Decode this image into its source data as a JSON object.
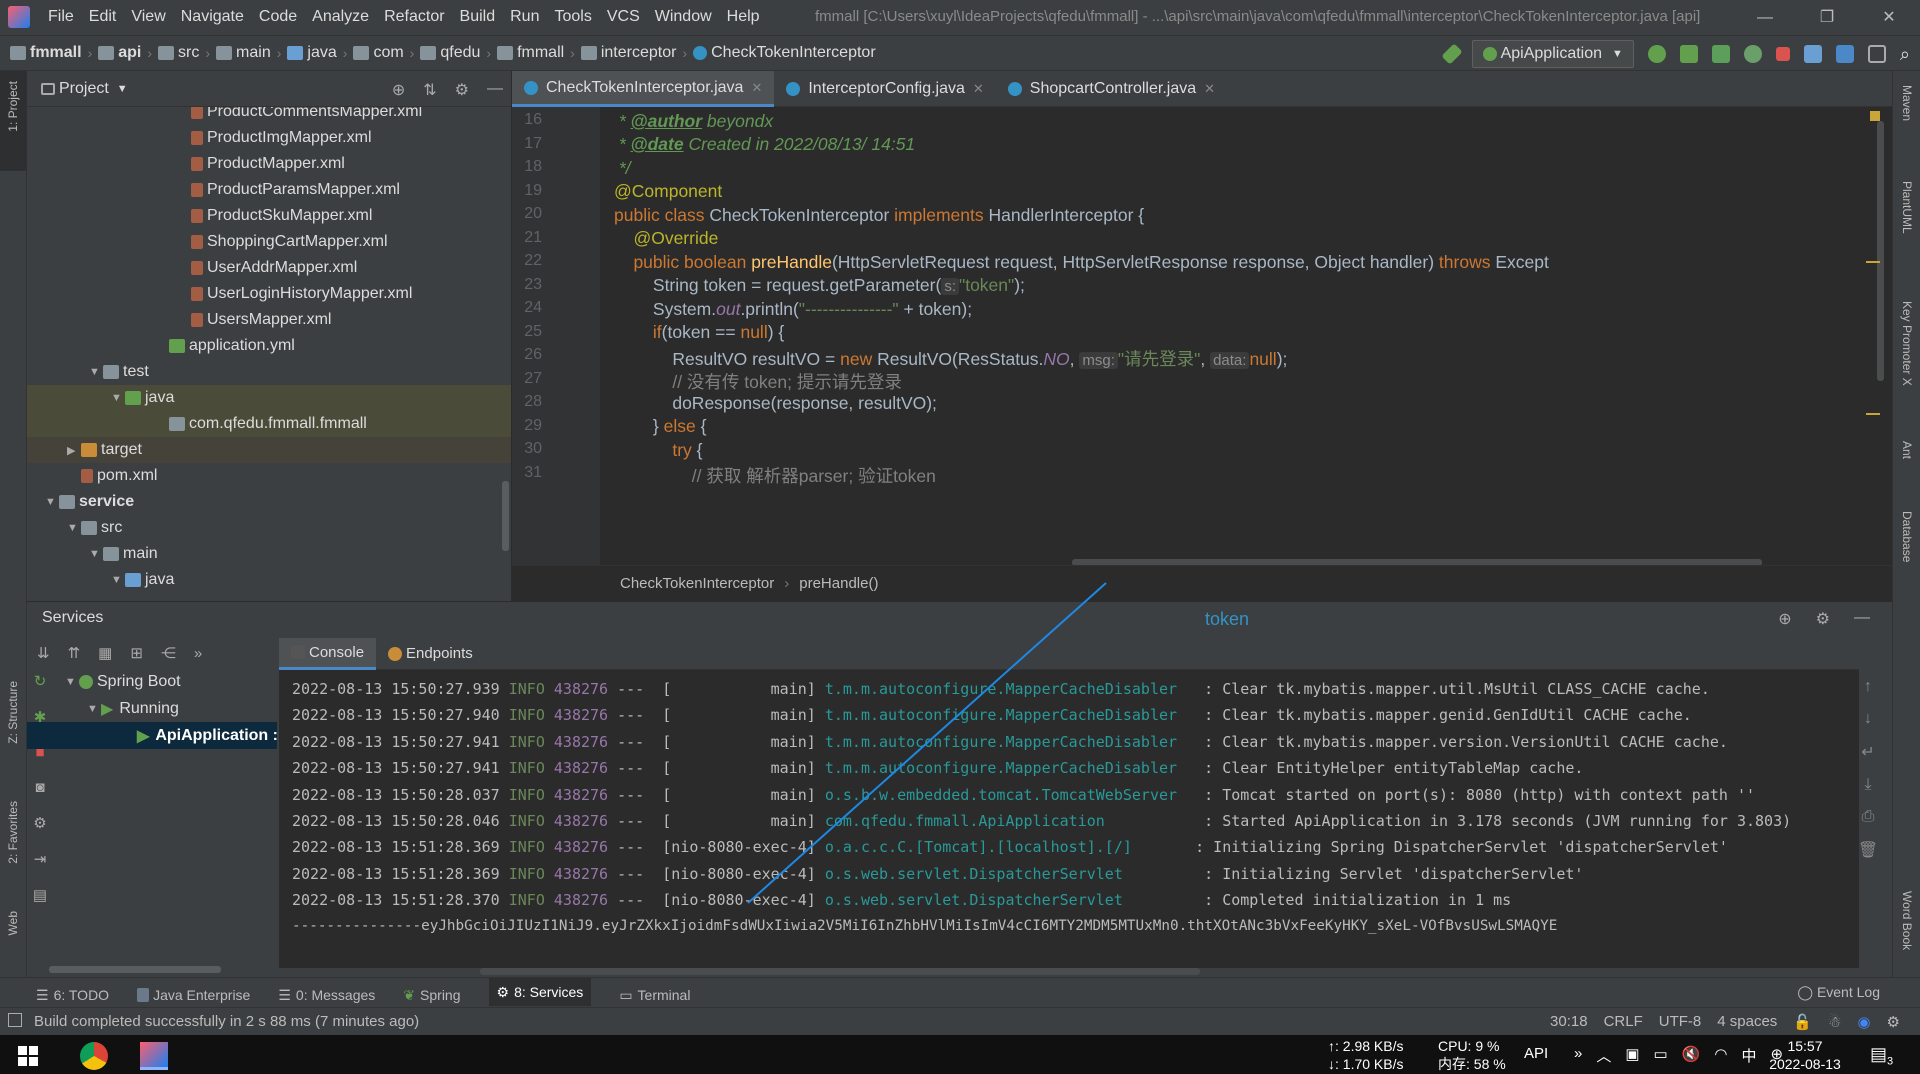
{
  "menubar": {
    "items": [
      "File",
      "Edit",
      "View",
      "Navigate",
      "Code",
      "Analyze",
      "Refactor",
      "Build",
      "Run",
      "Tools",
      "VCS",
      "Window",
      "Help"
    ],
    "title": "fmmall [C:\\Users\\xuyl\\IdeaProjects\\qfedu\\fmmall] - ...\\api\\src\\main\\java\\com\\qfedu\\fmmall\\interceptor\\CheckTokenInterceptor.java [api]"
  },
  "breadcrumb": [
    "fmmall",
    "api",
    "src",
    "main",
    "java",
    "com",
    "qfedu",
    "fmmall",
    "interceptor",
    "CheckTokenInterceptor"
  ],
  "run_config": "ApiApplication",
  "left_stripe": {
    "project": "1: Project",
    "structure": "Z: Structure",
    "favorites": "2: Favorites",
    "web": "Web"
  },
  "right_stripe": {
    "maven": "Maven",
    "plantuml": "PlantUML",
    "keypromoter": "Key Promoter X",
    "ant": "Ant",
    "database": "Database",
    "wordbook": "Word Book"
  },
  "project_panel": {
    "title": "Project",
    "tree": [
      {
        "label": "ProductCommentsMapper.xml",
        "kind": "xml",
        "depth": 7
      },
      {
        "label": "ProductImgMapper.xml",
        "kind": "xml",
        "depth": 7
      },
      {
        "label": "ProductMapper.xml",
        "kind": "xml",
        "depth": 7
      },
      {
        "label": "ProductParamsMapper.xml",
        "kind": "xml",
        "depth": 7
      },
      {
        "label": "ProductSkuMapper.xml",
        "kind": "xml",
        "depth": 7
      },
      {
        "label": "ShoppingCartMapper.xml",
        "kind": "xml",
        "depth": 7
      },
      {
        "label": "UserAddrMapper.xml",
        "kind": "xml",
        "depth": 7
      },
      {
        "label": "UserLoginHistoryMapper.xml",
        "kind": "xml",
        "depth": 7
      },
      {
        "label": "UsersMapper.xml",
        "kind": "xml",
        "depth": 7
      },
      {
        "label": "application.yml",
        "kind": "yml",
        "depth": 6
      },
      {
        "label": "test",
        "kind": "folder",
        "depth": 3,
        "arrow": "▼"
      },
      {
        "label": "java",
        "kind": "folder-green",
        "depth": 4,
        "arrow": "▼",
        "selected": true
      },
      {
        "label": "com.qfedu.fmmall.fmmall",
        "kind": "folder",
        "depth": 6,
        "selected": true
      },
      {
        "label": "target",
        "kind": "folder-orange",
        "depth": 2,
        "arrow": "▶",
        "selected2": true
      },
      {
        "label": "pom.xml",
        "kind": "maven",
        "depth": 2
      },
      {
        "label": "service",
        "kind": "folder",
        "depth": 1,
        "arrow": "▼",
        "bold": true
      },
      {
        "label": "src",
        "kind": "folder",
        "depth": 2,
        "arrow": "▼"
      },
      {
        "label": "main",
        "kind": "folder",
        "depth": 3,
        "arrow": "▼"
      },
      {
        "label": "java",
        "kind": "folder-blue",
        "depth": 4,
        "arrow": "▼"
      }
    ]
  },
  "editor": {
    "tabs": [
      {
        "label": "CheckTokenInterceptor.java",
        "active": true
      },
      {
        "label": "InterceptorConfig.java",
        "active": false
      },
      {
        "label": "ShopcartController.java",
        "active": false
      }
    ],
    "line_numbers": [
      "16",
      "17",
      "18",
      "19",
      "20",
      "21",
      "22",
      "23",
      "24",
      "25",
      "26",
      "27",
      "28",
      "29",
      "30",
      "31"
    ],
    "code": {
      "l16": [
        " * ",
        "@author",
        " beyondx"
      ],
      "l17": [
        " * ",
        "@date",
        " Created in 2022/08/13/ 14:51"
      ],
      "l18": " */",
      "l19": "@Component",
      "l20": [
        "public class ",
        "CheckTokenInterceptor ",
        "implements ",
        "HandlerInterceptor {"
      ],
      "l21": "    @Override",
      "l22": [
        "    public boolean ",
        "preHandle",
        "(HttpServletRequest request, HttpServletResponse response, Object handler) ",
        "throws ",
        "Except"
      ],
      "l23": [
        "        String token = request.getParameter(",
        "s:",
        "\"token\"",
        ");"
      ],
      "l24": [
        "        System.",
        "out",
        ".println(",
        "\"---------------\"",
        " + token);"
      ],
      "l25": [
        "        ",
        "if",
        "(token == ",
        "null",
        ") {"
      ],
      "l26": [
        "            ResultVO resultVO = ",
        "new ",
        "ResultVO(ResStatus.",
        "NO",
        ", ",
        "msg:",
        "\"请先登录\"",
        ", ",
        "data:",
        "null",
        ");"
      ],
      "l27": "            // 没有传 token; 提示请先登录",
      "l28": "            doResponse(response, resultVO);",
      "l29": [
        "        } ",
        "else ",
        "{"
      ],
      "l30": [
        "            ",
        "try ",
        "{"
      ],
      "l31": "                // 获取 解析器parser; 验证token"
    },
    "breadcrumb": [
      "CheckTokenInterceptor",
      "preHandle()"
    ]
  },
  "services": {
    "title": "Services",
    "token_label": "token",
    "tree": [
      {
        "label": "Spring Boot",
        "arrow": "▼"
      },
      {
        "label": "Running",
        "arrow": "▼"
      },
      {
        "label": "ApiApplication :",
        "selected": true
      }
    ],
    "console_tabs": [
      "Console",
      "Endpoints"
    ],
    "logs": [
      {
        "ts": "2022-08-13 15:50:27.939",
        "level": "INFO",
        "pid": "438276",
        "thread": "---  [           main]",
        "logger": "t.m.m.autoconfigure.MapperCacheDisabler  ",
        "msg": ": Clear tk.mybatis.mapper.util.MsUtil CLASS_CACHE cache."
      },
      {
        "ts": "2022-08-13 15:50:27.940",
        "level": "INFO",
        "pid": "438276",
        "thread": "---  [           main]",
        "logger": "t.m.m.autoconfigure.MapperCacheDisabler  ",
        "msg": ": Clear tk.mybatis.mapper.genid.GenIdUtil CACHE cache."
      },
      {
        "ts": "2022-08-13 15:50:27.941",
        "level": "INFO",
        "pid": "438276",
        "thread": "---  [           main]",
        "logger": "t.m.m.autoconfigure.MapperCacheDisabler  ",
        "msg": ": Clear tk.mybatis.mapper.version.VersionUtil CACHE cache."
      },
      {
        "ts": "2022-08-13 15:50:27.941",
        "level": "INFO",
        "pid": "438276",
        "thread": "---  [           main]",
        "logger": "t.m.m.autoconfigure.MapperCacheDisabler  ",
        "msg": ": Clear EntityHelper entityTableMap cache."
      },
      {
        "ts": "2022-08-13 15:50:28.037",
        "level": "INFO",
        "pid": "438276",
        "thread": "---  [           main]",
        "logger": "o.s.b.w.embedded.tomcat.TomcatWebServer  ",
        "msg": ": Tomcat started on port(s): 8080 (http) with context path ''"
      },
      {
        "ts": "2022-08-13 15:50:28.046",
        "level": "INFO",
        "pid": "438276",
        "thread": "---  [           main]",
        "logger": "com.qfedu.fmmall.ApiApplication          ",
        "msg": ": Started ApiApplication in 3.178 seconds (JVM running for 3.803)"
      },
      {
        "ts": "2022-08-13 15:51:28.369",
        "level": "INFO",
        "pid": "438276",
        "thread": "---  [nio-8080-exec-4]",
        "logger": "o.a.c.c.C.[Tomcat].[localhost].[/]      ",
        "msg": ": Initializing Spring DispatcherServlet 'dispatcherServlet'"
      },
      {
        "ts": "2022-08-13 15:51:28.369",
        "level": "INFO",
        "pid": "438276",
        "thread": "---  [nio-8080-exec-4]",
        "logger": "o.s.web.servlet.DispatcherServlet        ",
        "msg": ": Initializing Servlet 'dispatcherServlet'"
      },
      {
        "ts": "2022-08-13 15:51:28.370",
        "level": "INFO",
        "pid": "438276",
        "thread": "---  [nio-8080-exec-4]",
        "logger": "o.s.web.servlet.DispatcherServlet        ",
        "msg": ": Completed initialization in 1 ms"
      }
    ],
    "token_line": "---------------eyJhbGciOiJIUzI1NiJ9.eyJrZXkxIjoidmFsdWUxIiwia2V5MiI6InZhbHVlMiIsImV4cCI6MTY2MDM5MTUxMn0.thtXOtANc3bVxFeeKyHKY_sXeL-VOfBvsUSwLSMAQYE"
  },
  "toolwindows": [
    {
      "label": "6: TODO"
    },
    {
      "label": "Java Enterprise"
    },
    {
      "label": "0: Messages"
    },
    {
      "label": "Spring"
    },
    {
      "label": "8: Services",
      "active": true
    },
    {
      "label": "Terminal"
    }
  ],
  "event_log": "Event Log",
  "statusbar": {
    "message": "Build completed successfully in 2 s 88 ms (7 minutes ago)",
    "position": "30:18",
    "line_sep": "CRLF",
    "encoding": "UTF-8",
    "indent": "4 spaces"
  },
  "taskbar": {
    "net_up": "↑: 2.98 KB/s",
    "net_down": "↓: 1.70 KB/s",
    "cpu": "CPU: 9 %",
    "mem": "内存: 58 %",
    "api": "API",
    "ime": "中",
    "time": "15:57",
    "date": "2022-08-13",
    "notif_count": "3"
  },
  "colors": {
    "accent": "#4a88c7",
    "annotation_line": "#1e88e5",
    "token_label": "#3592c4"
  }
}
